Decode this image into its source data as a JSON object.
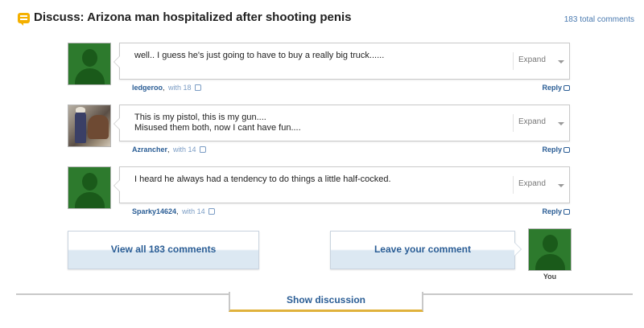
{
  "header": {
    "title": "Discuss: Arizona man hospitalized after shooting penis",
    "total_comments": "183 total comments"
  },
  "comments": [
    {
      "lines": [
        "well.. I guess he's just going to have to buy a really big truck......"
      ],
      "author": "ledgeroo",
      "with": "with 18",
      "expand": "Expand",
      "reply": "Reply",
      "avatar": "default-silhouette"
    },
    {
      "lines": [
        "This is my pistol, this is my gun....",
        "Misused them both, now I cant have fun...."
      ],
      "author": "Azrancher",
      "with": "with 14",
      "expand": "Expand",
      "reply": "Reply",
      "avatar": "photo"
    },
    {
      "lines": [
        "I heard he always had a tendency to do things a little half-cocked."
      ],
      "author": "Sparky14624",
      "with": "with 14",
      "expand": "Expand",
      "reply": "Reply",
      "avatar": "default-silhouette"
    }
  ],
  "actions": {
    "view_all": "View all 183 comments",
    "leave": "Leave your comment",
    "you_label": "You"
  },
  "footer": {
    "show_discussion": "Show discussion"
  },
  "colors": {
    "link": "#2a5d95",
    "avatar_green": "#2d7a2d",
    "discuss_icon": "#f4b000",
    "tab_underline": "#e0b23c"
  }
}
